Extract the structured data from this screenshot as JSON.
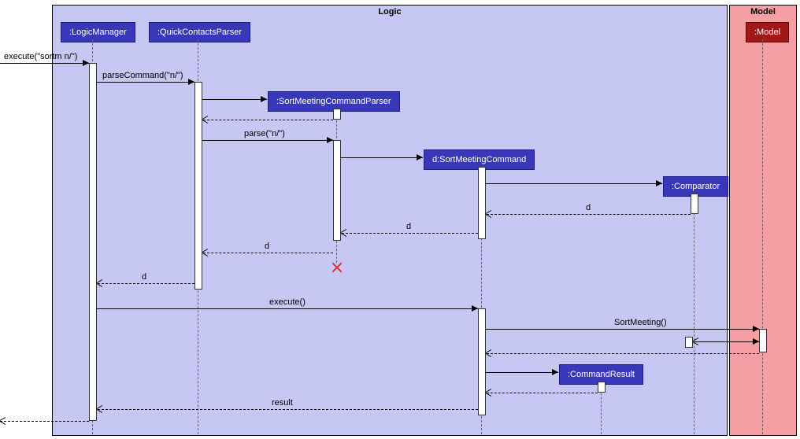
{
  "frames": {
    "logic": "Logic",
    "model": "Model"
  },
  "participants": {
    "logicManager": ":LogicManager",
    "quickContactsParser": ":QuickContactsParser",
    "sortMeetingCommandParser": ":SortMeetingCommandParser",
    "sortMeetingCommand": "d:SortMeetingCommand",
    "comparator": ":Comparator",
    "commandResult": ":CommandResult",
    "model": ":Model"
  },
  "messages": {
    "executeIn": "execute(\"sortm n/\")",
    "parseCommand": "parseCommand(\"n/\")",
    "parse": "parse(\"n/\")",
    "d1": "d",
    "d2": "d",
    "d3": "d",
    "d4": "d",
    "execute": "execute()",
    "sortMeeting": "SortMeeting()",
    "result": "result"
  }
}
